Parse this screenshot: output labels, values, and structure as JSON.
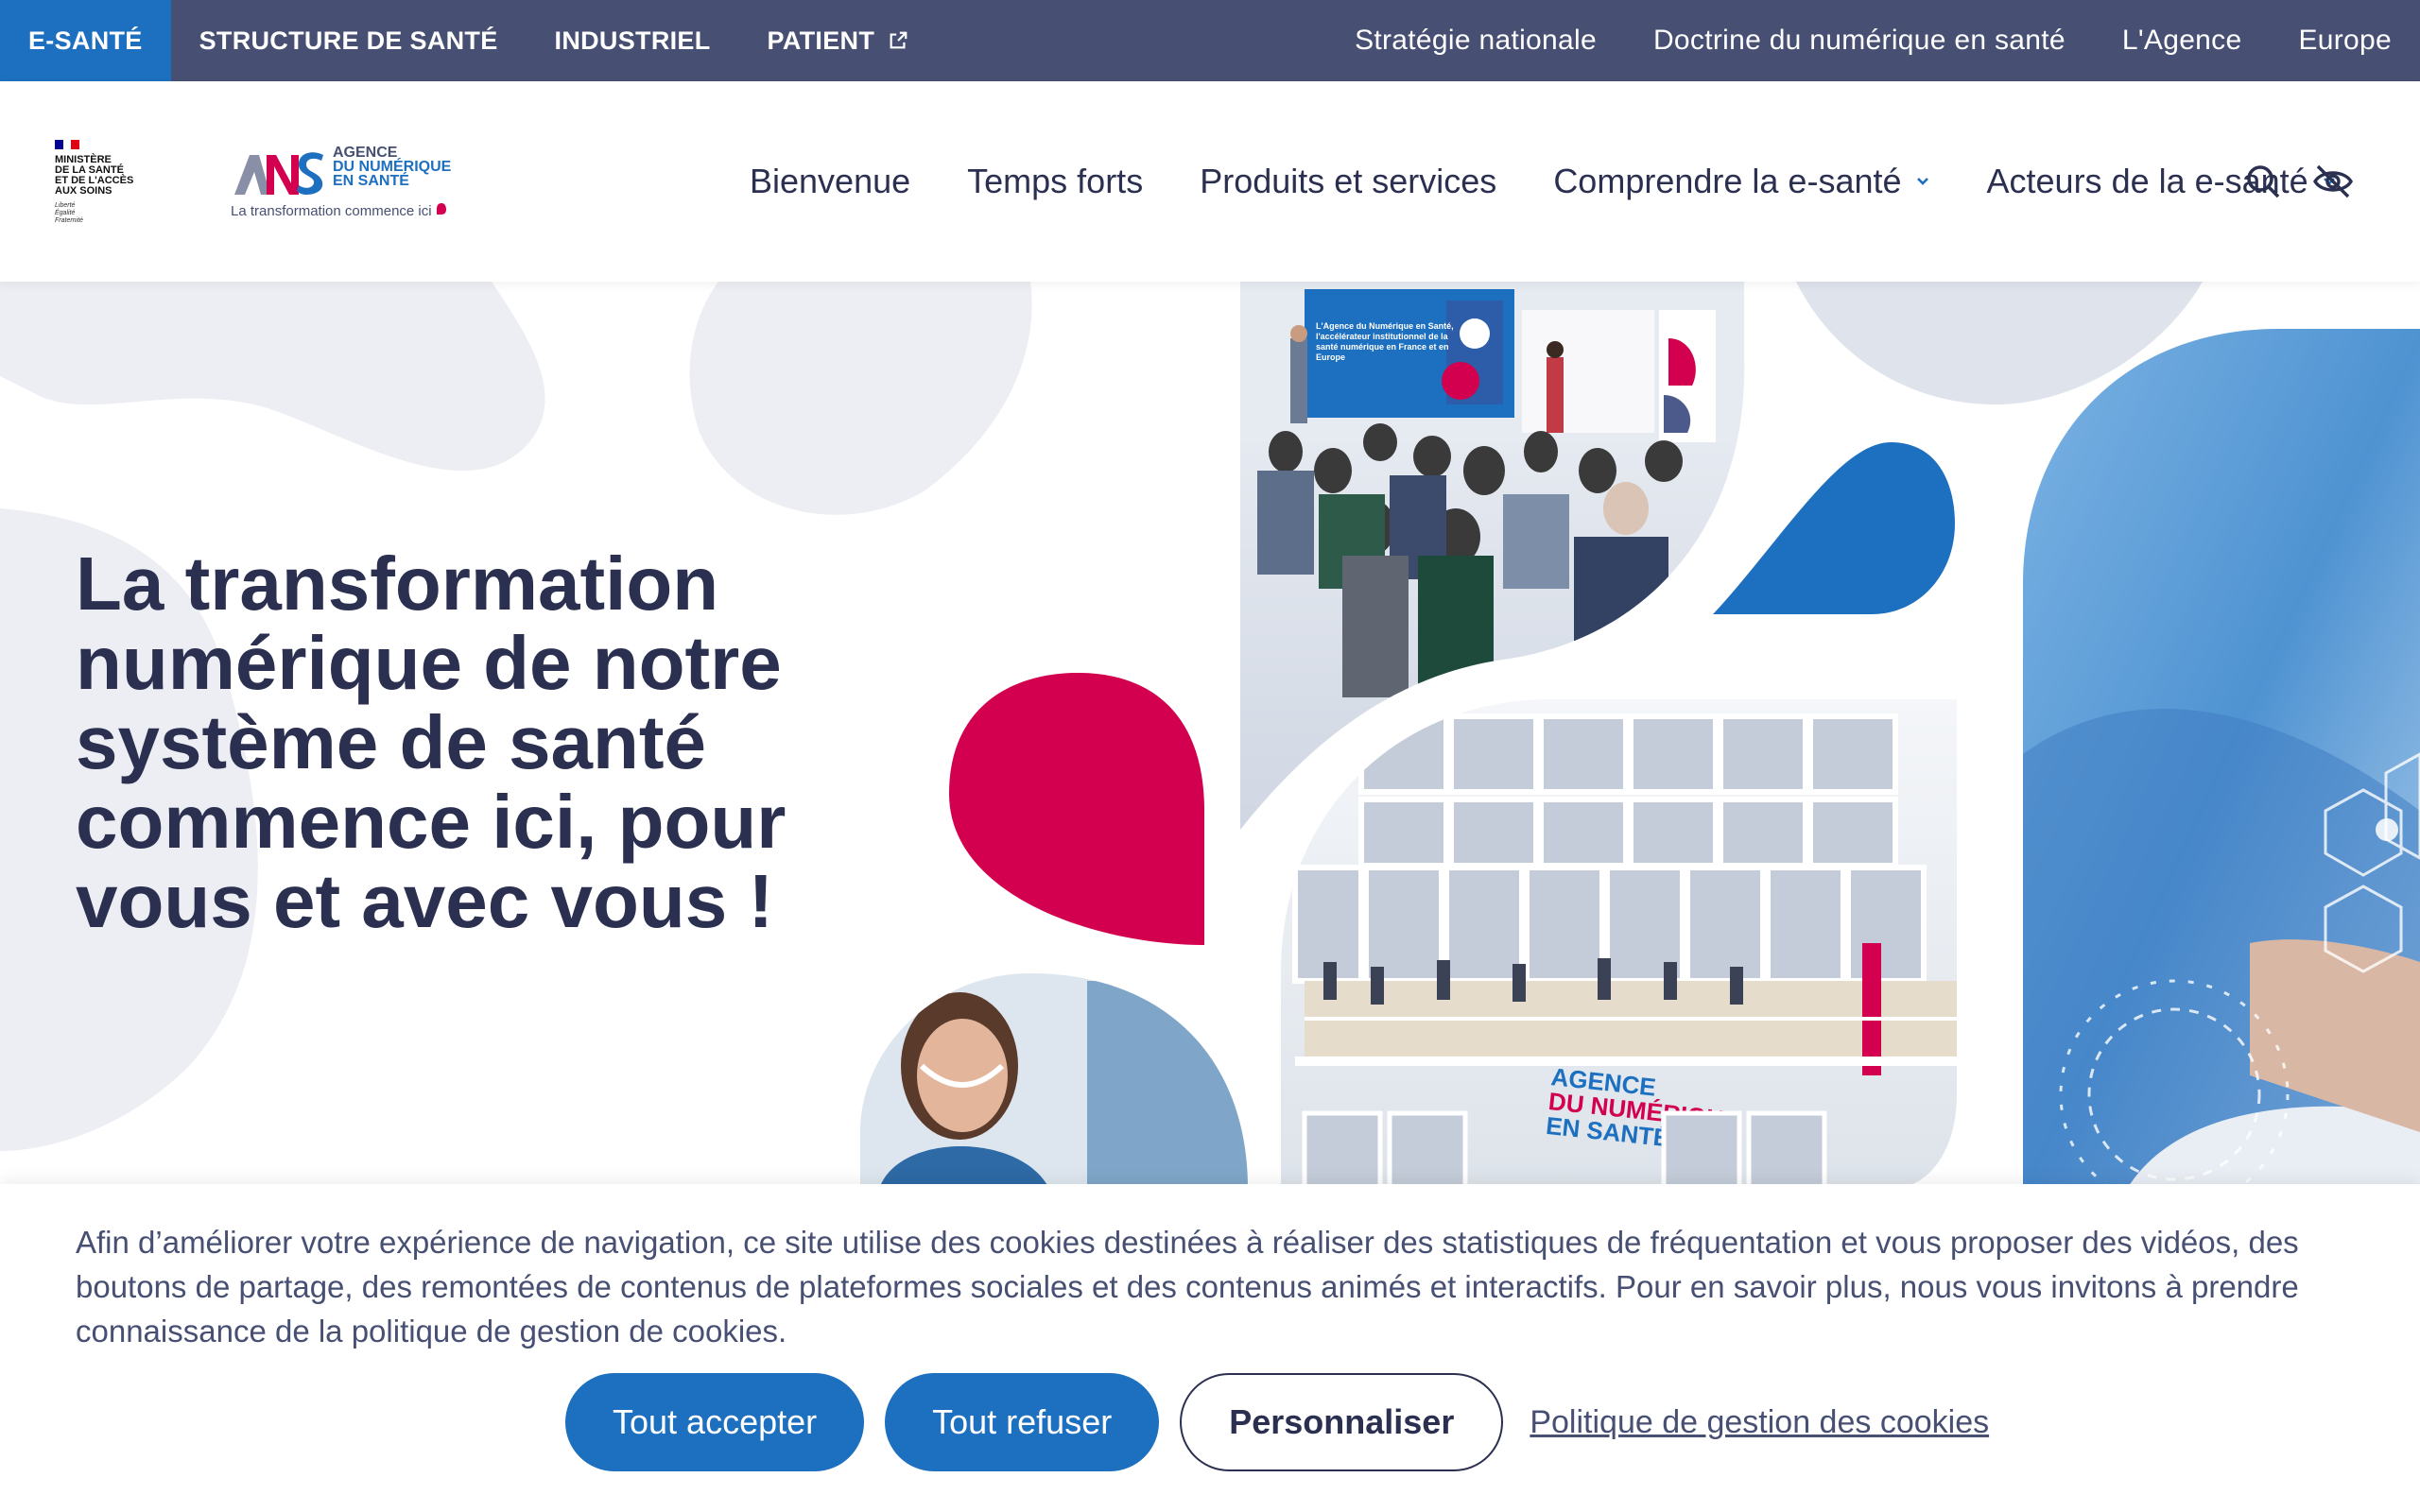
{
  "topbar": {
    "audiences": [
      {
        "label": "E-SANTÉ"
      },
      {
        "label": "STRUCTURE DE SANTÉ"
      },
      {
        "label": "INDUSTRIEL"
      },
      {
        "label": "PATIENT"
      }
    ],
    "links": [
      {
        "label": "Stratégie nationale"
      },
      {
        "label": "Doctrine du numérique en santé"
      },
      {
        "label": "L'Agence"
      },
      {
        "label": "Europe"
      }
    ]
  },
  "header": {
    "ministry": {
      "lines": [
        "MINISTÈRE",
        "DE LA SANTÉ",
        "ET DE L'ACCÈS",
        "AUX SOINS"
      ],
      "motto": [
        "Liberté",
        "Égalité",
        "Fraternité"
      ]
    },
    "ans_logo": {
      "line1": "AGENCE",
      "line2": "DU NUMÉRIQUE",
      "line3": "EN SANTÉ",
      "tagline": "La transformation commence ici"
    },
    "nav": [
      {
        "label": "Bienvenue"
      },
      {
        "label": "Temps forts"
      },
      {
        "label": "Produits et services"
      },
      {
        "label": "Comprendre la e-santé"
      },
      {
        "label": "Acteurs de la e-santé"
      }
    ]
  },
  "hero": {
    "headline": "La transformation numérique de notre système de santé commence ici, pour vous et avec vous !",
    "screen_text": "L'Agence du Numérique en Santé, l'accélérateur institutionnel de la santé numérique en France et en Europe",
    "building_sign": [
      "AGENCE",
      "DU NUMÉRIQUE",
      "EN SANTÉ"
    ]
  },
  "cookie_banner": {
    "text": "Afin d’améliorer votre expérience de navigation, ce site utilise des cookies destinées à réaliser des statistiques de fréquentation et vous proposer des vidéos, des boutons de partage, des remontées de contenus de plateformes sociales et des contenus animés et interactifs. Pour en savoir plus, nous vous invitons à prendre connaissance de la politique de gestion de cookies.",
    "accept_label": "Tout accepter",
    "refuse_label": "Tout refuser",
    "customize_label": "Personnaliser",
    "policy_label": "Politique de gestion des cookies"
  },
  "colors": {
    "topbar_bg": "#474f73",
    "active_tab": "#1d6fbf",
    "accent_blue": "#1d6fbf",
    "accent_red": "#d2004e",
    "text_dark": "#2b3050"
  }
}
